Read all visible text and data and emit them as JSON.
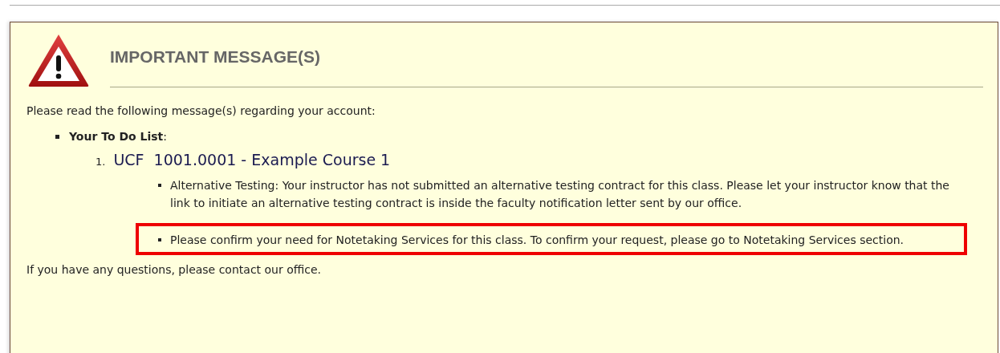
{
  "panel": {
    "title": "IMPORTANT MESSAGE(S)",
    "intro": "Please read the following message(s) regarding your account:",
    "list": {
      "label": "Your To Do List",
      "suffix": ":",
      "courses": [
        {
          "number": "1.",
          "title": "UCF  1001.0001 - Example Course 1",
          "messages": [
            {
              "text": "Alternative Testing: Your instructor has not submitted an alternative testing contract for this class. Please let your instructor know that the link to initiate an alternative testing contract is inside the faculty notification letter sent by our office.",
              "highlighted": false
            },
            {
              "text": "Please confirm your need for Notetaking Services for this class. To confirm your request, please go to Notetaking Services section.",
              "highlighted": true
            }
          ]
        }
      ]
    },
    "footer": "If you have any questions, please contact our office."
  }
}
